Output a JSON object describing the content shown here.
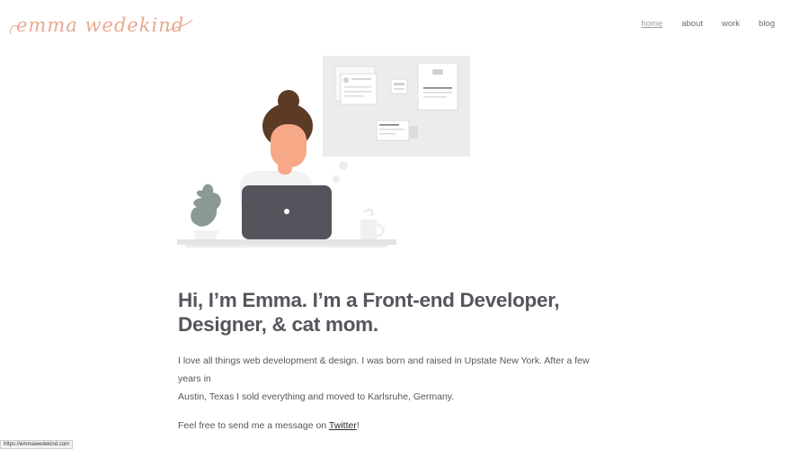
{
  "brand": {
    "logo_text": "emma wedekind"
  },
  "nav": {
    "items": [
      {
        "label": "home",
        "active": true
      },
      {
        "label": "about",
        "active": false
      },
      {
        "label": "work",
        "active": false
      },
      {
        "label": "blog",
        "active": false
      }
    ]
  },
  "main": {
    "headline_line1": "Hi, I’m Emma. I’m a Front-end Developer,",
    "headline_line2": "Designer, & cat mom.",
    "intro_line1": "I love all things web development & design. I was born and raised in Upstate New York. After a few years in",
    "intro_line2": "Austin, Texas I sold everything and moved to Karlsruhe, Germany.",
    "contact_prefix": "Feel free to send me a message on ",
    "contact_link": "Twitter",
    "contact_suffix": "!"
  },
  "status_bar": {
    "url": "https://emmawedekind.com"
  },
  "colors": {
    "brand": "#e8a98f",
    "laptop": "#55545c",
    "skin": "#f6a887",
    "hair": "#5b3a26"
  }
}
